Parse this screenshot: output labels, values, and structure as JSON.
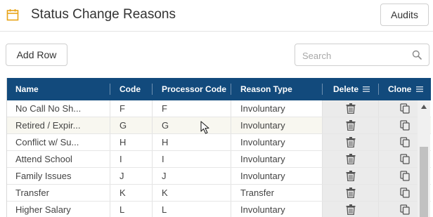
{
  "header": {
    "title": "Status Change Reasons",
    "audits_label": "Audits"
  },
  "toolbar": {
    "add_row_label": "Add Row",
    "search_placeholder": "Search",
    "search_value": ""
  },
  "table": {
    "columns": {
      "name": "Name",
      "code": "Code",
      "processor_code": "Processor Code",
      "reason_type": "Reason Type",
      "delete": "Delete",
      "clone": "Clone"
    },
    "rows": [
      {
        "name": "No Call No Sh...",
        "code": "F",
        "processor_code": "F",
        "reason_type": "Involuntary"
      },
      {
        "name": "Retired / Expir...",
        "code": "G",
        "processor_code": "G",
        "reason_type": "Involuntary"
      },
      {
        "name": "Conflict w/ Su...",
        "code": "H",
        "processor_code": "H",
        "reason_type": "Involuntary"
      },
      {
        "name": "Attend School",
        "code": "I",
        "processor_code": "I",
        "reason_type": "Involuntary"
      },
      {
        "name": "Family Issues",
        "code": "J",
        "processor_code": "J",
        "reason_type": "Involuntary"
      },
      {
        "name": "Transfer",
        "code": "K",
        "processor_code": "K",
        "reason_type": "Transfer"
      },
      {
        "name": "Higher Salary",
        "code": "L",
        "processor_code": "L",
        "reason_type": "Involuntary"
      }
    ]
  },
  "icons": {
    "title_icon": "calendar-icon",
    "search_icon": "search-icon",
    "delete_icon": "trash-icon",
    "clone_icon": "copy-icon",
    "column_menu_icon": "column-menu-icon"
  },
  "colors": {
    "header_bg": "#124a7c",
    "accent_icon": "#e8a317",
    "row_alt_bg": "#f8f7f0",
    "action_col_bg": "#ebebeb"
  }
}
